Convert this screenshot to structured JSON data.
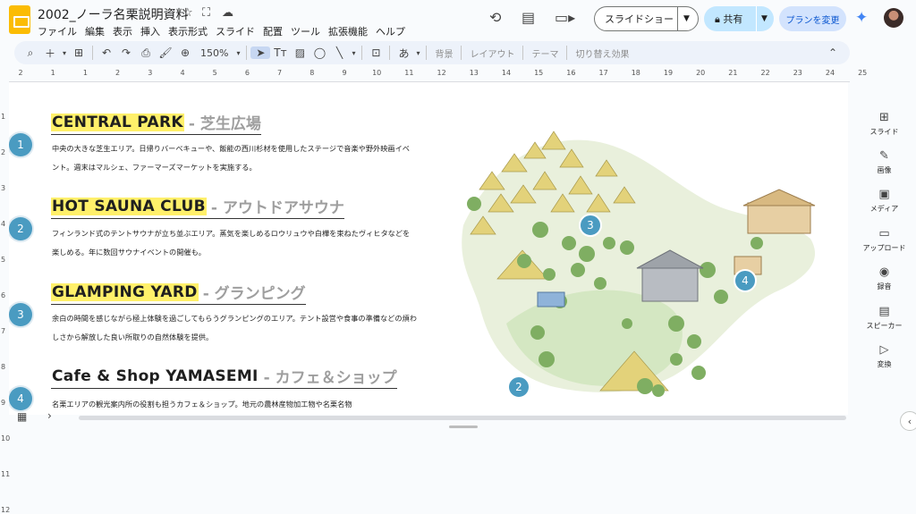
{
  "app": {
    "title": "2002_ノーラ名栗説明資料"
  },
  "menu": [
    "ファイル",
    "編集",
    "表示",
    "挿入",
    "表示形式",
    "スライド",
    "配置",
    "ツール",
    "拡張機能",
    "ヘルプ"
  ],
  "header": {
    "slideshow_label": "スライドショー",
    "share_label": "共有",
    "plan_label": "プランを変更"
  },
  "toolbar": {
    "zoom": "150%",
    "background": "背景",
    "layout": "レイアウト",
    "theme": "テーマ",
    "transition": "切り替え効果"
  },
  "ruler": {
    "h": [
      "2",
      "1",
      "1",
      "2",
      "3",
      "4",
      "5",
      "6",
      "7",
      "8",
      "9",
      "10",
      "11",
      "12",
      "13",
      "14",
      "15",
      "16",
      "17",
      "18",
      "19",
      "20",
      "21",
      "22",
      "23",
      "24",
      "25"
    ],
    "v": [
      "1",
      "2",
      "3",
      "4",
      "5",
      "6",
      "7",
      "8",
      "9",
      "10",
      "11",
      "12"
    ]
  },
  "slide": {
    "sections": [
      {
        "num": "1",
        "en": "CENTRAL PARK",
        "jp": "- 芝生広場",
        "desc": "中央の大きな芝生エリア。日帰りバーベキューや、飯能の西川杉材を使用したステージで音楽や野外映画イベント。週末はマルシェ、ファーマーズマーケットを実施する。"
      },
      {
        "num": "2",
        "en": "HOT SAUNA CLUB",
        "jp": "- アウトドアサウナ",
        "desc": "フィンランド式のテントサウナが立ち並ぶエリア。蒸気を楽しめるロウリュウや白樺を束ねたヴィヒタなどを楽しめる。年に数回サウナイベントの開催も。"
      },
      {
        "num": "3",
        "en": "GLAMPING YARD",
        "jp": "- グランピング",
        "desc": "余白の時間を感じながら極上体験を過ごしてもらうグランピングのエリア。テント設営や食事の準備などの煩わしさから解放した良い所取りの自然体験を提供。"
      },
      {
        "num": "4",
        "en": "Cafe & Shop YAMASEMI",
        "jp": "- カフェ＆ショップ",
        "desc": "名栗エリアの観光案内所の役割も担うカフェ＆ショップ。地元の農林産物加工物や名栗名物"
      }
    ],
    "map_markers": [
      "1",
      "2",
      "3",
      "4"
    ]
  },
  "right_panel": [
    {
      "icon": "add-slide-icon",
      "label": "スライド"
    },
    {
      "icon": "image-icon",
      "label": "画像"
    },
    {
      "icon": "media-icon",
      "label": "メディア"
    },
    {
      "icon": "folder-icon",
      "label": "アップロード"
    },
    {
      "icon": "record-icon",
      "label": "録音"
    },
    {
      "icon": "speaker-icon",
      "label": "スピーカー"
    },
    {
      "icon": "convert-icon",
      "label": "変換"
    }
  ],
  "colors": {
    "highlight": "#fff06a",
    "badge": "#4a9bc1",
    "accent": "#0b57d0"
  }
}
